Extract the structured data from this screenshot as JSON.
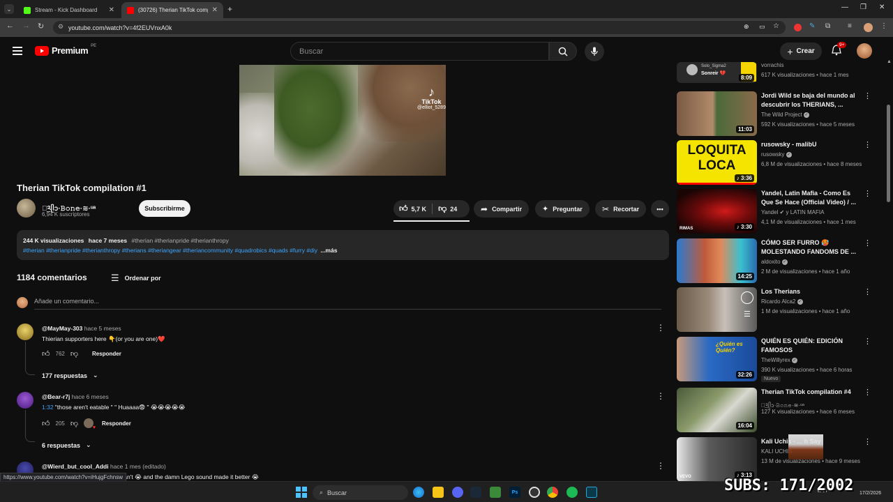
{
  "browser": {
    "tabs": [
      {
        "title": "Stream - Kick Dashboard",
        "favicon_color": "#53fc18"
      },
      {
        "title": "(30726) Therian TikTok compilation",
        "favicon_color": "#ff0000"
      }
    ],
    "url": "youtube.com/watch?v=4f2EUVnxA0k",
    "status_url": "https://www.youtube.com/watch?v=iHujgFchnsw"
  },
  "yt_header": {
    "logo_text": "Premium",
    "logo_region": "PE",
    "search_placeholder": "Buscar",
    "create_label": "Crear",
    "notif_badge": "9+"
  },
  "video": {
    "watermark": "TikTok",
    "watermark_user": "@elliot_5289",
    "title": "Therian TikTok compilation #1",
    "channel": "ৃ͢༢ᥫᩣ·𝙱𝚘𝚗𝚎·≋·ᵘᵃ",
    "subscribers": "6,94 K suscriptores",
    "subscribe_label": "Subscribirme",
    "likes": "5,7 K",
    "dislikes": "24",
    "share_label": "Compartir",
    "ask_label": "Preguntar",
    "clip_label": "Recortar"
  },
  "description": {
    "views": "244 K visualizaciones",
    "date": "hace 7 meses",
    "tags_line1": "#therian #therianpride #therianthropy",
    "tags_line2": "#therian #therianpride #therianthropy #therians #theriangear #theriancommunity #quadrobics #quads #furry #diy",
    "more": "...más"
  },
  "comments": {
    "count": "1184 comentarios",
    "sort_label": "Ordenar por",
    "add_placeholder": "Añade un comentario...",
    "reply_label": "Responder",
    "items": [
      {
        "author": "@MayMay-303",
        "time": "hace 5 meses",
        "text": "Thierian supporters here 👇(or you are one)❤️",
        "likes": "762",
        "replies": "177 respuestas",
        "avatar_color": "#c9a94a"
      },
      {
        "author": "@Bear-r7j",
        "time": "hace 6 meses",
        "timestamp": "1:32",
        "text": " \"those aren't eatable \" \" Huaaaa😨 \" 😭😭😭😭😭",
        "likes": "205",
        "replies": "6 respuestas",
        "avatar_color": "#6a2fa0"
      },
      {
        "author": "@Wierd_but_cool_Addi",
        "time": "hace 1 mes (editado)",
        "text": "can't 😭 and the damn Lego sound made it better 😭",
        "avatar_color": "#2a2a6a"
      }
    ]
  },
  "sidebar": {
    "items": [
      {
        "title": "",
        "channel": "vorrachis",
        "meta": "617 K visualizaciones • hace 1 mes",
        "duration": "8:09",
        "thumb": "#2a2a2a",
        "thumb_label": "Solo_Sigma2\nSonreir 💔"
      },
      {
        "title": "Jordi Wild se baja del mundo al descubrir los THERIANS, ...",
        "channel": "The Wild Project",
        "meta": "592 K visualizaciones • hace 5 meses",
        "duration": "11:03",
        "thumb": "#6b4a36"
      },
      {
        "title": "rusowsky - malibU",
        "channel": "rusowsky",
        "meta": "6,8 M de visualizaciones • hace 8 meses",
        "duration": "3:36",
        "thumb": "#f5e400",
        "thumb_label": "LOQUITA\nLOCA"
      },
      {
        "title": "Yandel, Latin Mafia - Como Es Que Se Hace (Official Video) / ...",
        "channel": "Yandel ✔ y LATIN MAFIA",
        "meta": "4,1 M de visualizaciones • hace 1 mes",
        "duration": "3:30",
        "thumb": "#5a0d0d"
      },
      {
        "title": "CÓMO SER FURRO 🥵 MOLESTANDO FANDOMS DE ...",
        "channel": "aldoxito",
        "meta": "2 M de visualizaciones • hace 1 año",
        "duration": "14:25",
        "thumb": "#3a7ab5"
      },
      {
        "title": "Los Therians",
        "channel": "Ricardo Alca2",
        "meta": "1 M de visualizaciones • hace 1 año",
        "duration": "",
        "thumb": "#8a8a8a"
      },
      {
        "title": "QUIÉN ES QUIÉN: EDICIÓN FAMOSOS",
        "channel": "TheWillyrex",
        "meta": "390 K visualizaciones • hace 6 horas",
        "duration": "32:26",
        "thumb": "#2a6fc4",
        "badge": "Nuevo"
      },
      {
        "title": "Therian TikTok compilation #4",
        "channel": "ৃ͢༢ᥫᩣ·𝙱𝚘𝚗𝚎·≋·ᵘᵃ",
        "meta": "127 K visualizaciones • hace 6 meses",
        "duration": "16:04",
        "thumb": "#5a6a4a"
      },
      {
        "title": "Kali Uchis - ... h Say",
        "channel": "KALI UCHIS",
        "meta": "13 M de visualizaciones • hace 9 meses",
        "duration": "3:13",
        "thumb": "#4a4a4a"
      }
    ]
  },
  "taskbar": {
    "search_label": "Buscar",
    "overlay_text": "SUBS: 171/2002",
    "date": "17/2/2026",
    "lang": "LAA"
  }
}
